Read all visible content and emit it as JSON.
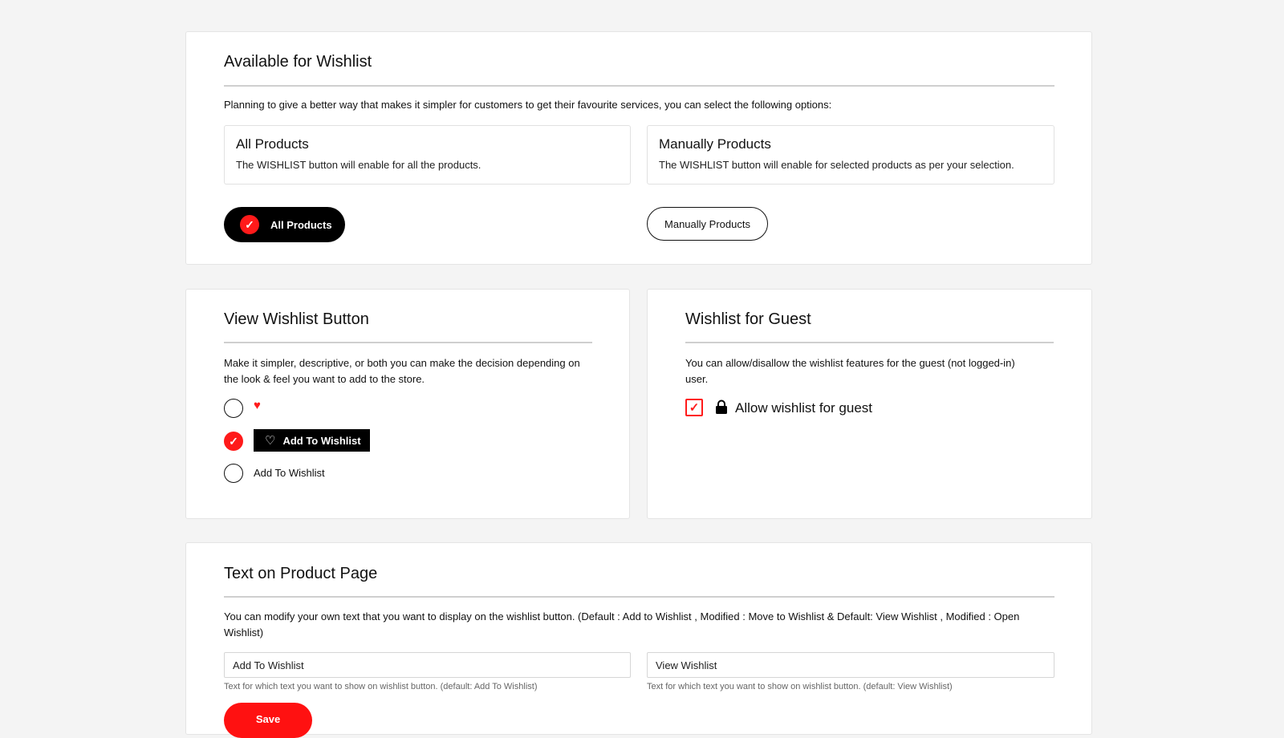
{
  "availability": {
    "title": "Available for Wishlist",
    "description": "Planning to give a better way that makes it simpler for customers to get their favourite services, you can select the following options:",
    "options": [
      {
        "title": "All Products",
        "description": "The WISHLIST button will enable for all the products."
      },
      {
        "title": "Manually Products",
        "description": "The WISHLIST button will enable for selected products as per your selection."
      }
    ],
    "selected_button_label": "All Products",
    "unselected_button_label": "Manually Products",
    "check_glyph": "✓"
  },
  "view_button": {
    "title": "View Wishlist Button",
    "description": "Make it simpler, descriptive, or both you can make the decision depending on the look & feel you want to add to the store.",
    "styles": [
      {
        "type": "icon-only",
        "icon": "heart-icon",
        "selected": false
      },
      {
        "type": "icon-and-text",
        "label": "Add To Wishlist",
        "selected": true
      },
      {
        "type": "text-only",
        "label": "Add To Wishlist",
        "selected": false
      }
    ]
  },
  "guest": {
    "title": "Wishlist for Guest",
    "description": "You can allow/disallow the wishlist features for the guest (not logged-in) user.",
    "checkbox_label": "Allow wishlist for guest",
    "checked": true
  },
  "product_text": {
    "title": "Text on Product Page",
    "description": "You can modify your own text that you want to display on the wishlist button. (Default : Add to Wishlist , Modified : Move to Wishlist & Default: View Wishlist , Modified : Open Wishlist)",
    "add_field_value": "Add To Wishlist",
    "add_field_help": "Text for which text you want to show on wishlist button. (default: Add To Wishlist)",
    "view_field_value": "View Wishlist",
    "view_field_help": "Text for which text you want to show on wishlist button. (default: View Wishlist)",
    "save_label": "Save"
  },
  "colors": {
    "accent": "#ff1a1a",
    "dark": "#000000",
    "background": "#f4f4f4"
  }
}
